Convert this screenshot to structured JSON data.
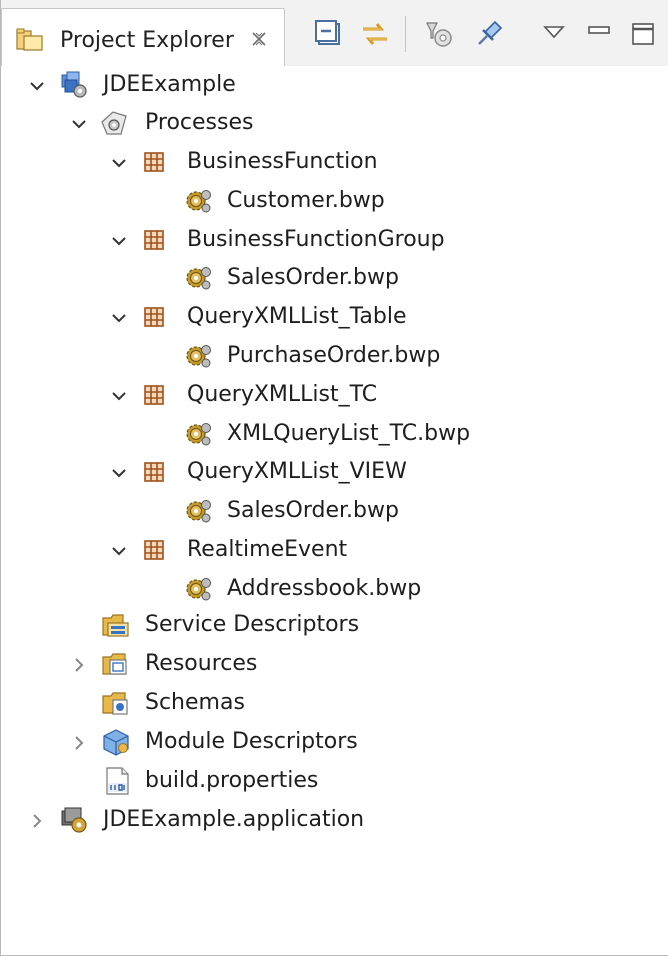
{
  "view": {
    "tab_title": "Project Explorer",
    "icons": {
      "tab": "project-explorer-icon",
      "close": "close-tab-icon",
      "toolbar": [
        "collapse-all-icon",
        "link-with-editor-icon",
        "filter-icon",
        "pin-icon",
        "view-menu-icon",
        "minimize-icon",
        "maximize-icon"
      ]
    }
  },
  "tree": {
    "project": {
      "label": "JDEExample",
      "icon": "project-icon"
    },
    "processes": {
      "label": "Processes",
      "icon": "processes-folder-icon"
    },
    "packages": [
      {
        "label": "BusinessFunction",
        "process": "Customer.bwp"
      },
      {
        "label": "BusinessFunctionGroup",
        "process": "SalesOrder.bwp"
      },
      {
        "label": "QueryXMLList_Table",
        "process": "PurchaseOrder.bwp"
      },
      {
        "label": "QueryXMLList_TC",
        "process": "XMLQueryList_TC.bwp"
      },
      {
        "label": "QueryXMLList_VIEW",
        "process": "SalesOrder.bwp"
      },
      {
        "label": "RealtimeEvent",
        "process": "Addressbook.bwp"
      }
    ],
    "service_descriptors": {
      "label": "Service Descriptors",
      "icon": "service-descriptors-icon"
    },
    "resources": {
      "label": "Resources",
      "icon": "resources-folder-icon"
    },
    "schemas": {
      "label": "Schemas",
      "icon": "schemas-folder-icon"
    },
    "module_descriptors": {
      "label": "Module Descriptors",
      "icon": "module-descriptors-icon"
    },
    "build_properties": {
      "label": "build.properties",
      "icon": "properties-file-icon"
    },
    "application": {
      "label": "JDEExample.application",
      "icon": "application-icon"
    }
  },
  "colors": {
    "package": "#a0521b",
    "gear": "#c49a2d",
    "folder": "#e8b84a",
    "blue": "#3a73c4"
  }
}
